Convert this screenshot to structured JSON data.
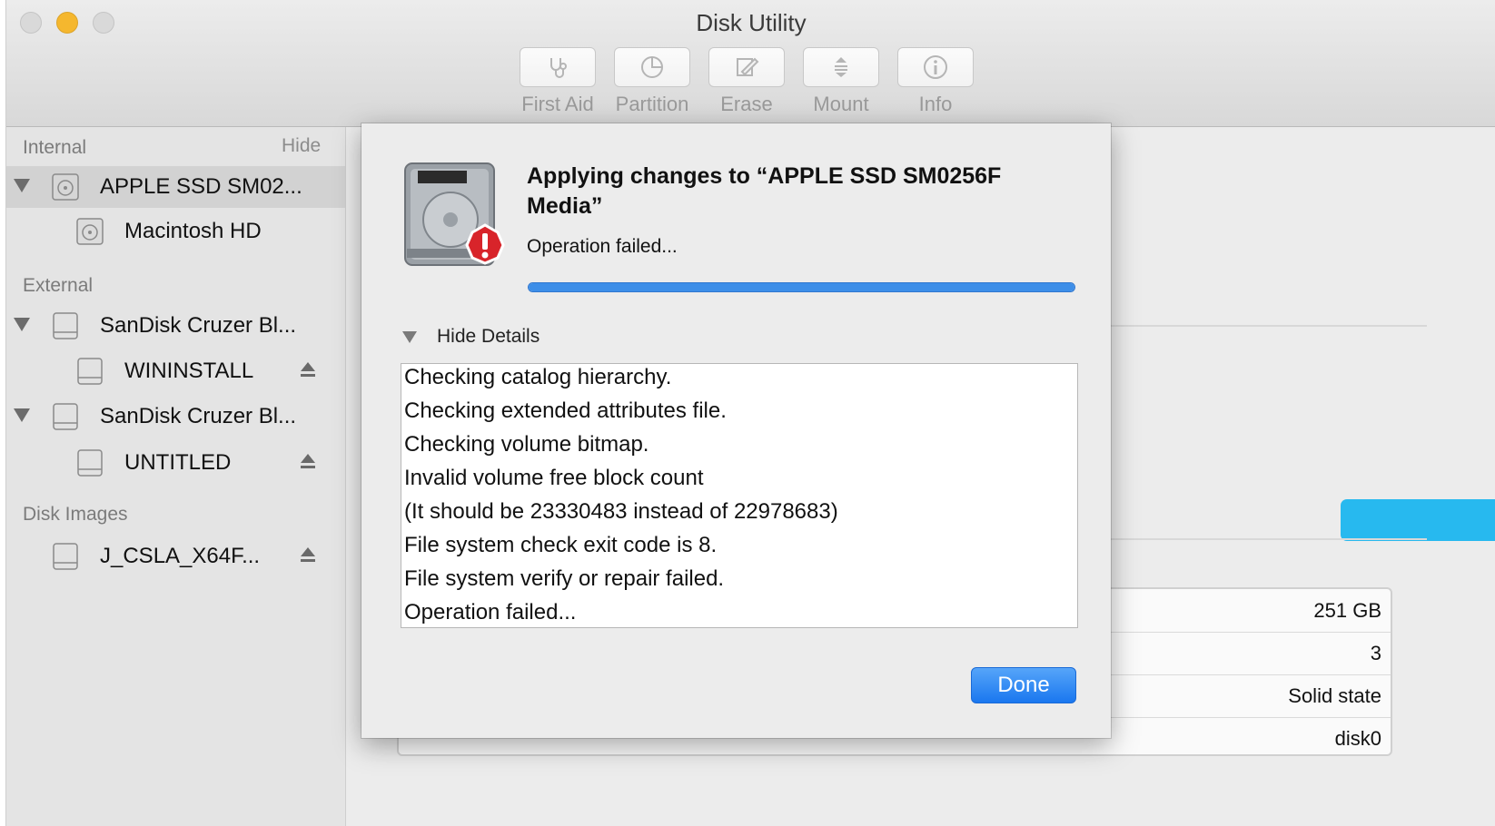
{
  "window": {
    "title": "Disk Utility"
  },
  "toolbar": {
    "buttons": [
      {
        "label": "First Aid",
        "icon": "stethoscope-icon"
      },
      {
        "label": "Partition",
        "icon": "pie-chart-icon"
      },
      {
        "label": "Erase",
        "icon": "pencil-eraser-icon"
      },
      {
        "label": "Mount",
        "icon": "mount-icon"
      },
      {
        "label": "Info",
        "icon": "info-icon"
      }
    ]
  },
  "sidebar": {
    "internal": {
      "heading": "Internal",
      "hide_label": "Hide",
      "disk": "APPLE SSD SM02...",
      "volume": "Macintosh HD"
    },
    "external": {
      "heading": "External",
      "disk1": "SanDisk Cruzer Bl...",
      "volume1": "WININSTALL",
      "disk2": "SanDisk Cruzer Bl...",
      "volume2": "UNTITLED"
    },
    "disk_images": {
      "heading": "Disk Images",
      "image1": "J_CSLA_X64F..."
    }
  },
  "main": {
    "usage_bar_color": "#27b9ef",
    "info_values": [
      "251 GB",
      "3",
      "Solid state",
      "disk0"
    ]
  },
  "dialog": {
    "title": "Applying changes to “APPLE SSD SM0256F Media”",
    "status": "Operation failed...",
    "progress": 1.0,
    "details_toggle": "Hide Details",
    "log_lines": [
      "Checking catalog hierarchy.",
      "Checking extended attributes file.",
      "Checking volume bitmap.",
      "Invalid volume free block count",
      "(It should be 23330483 instead of 22978683)",
      "File system check exit code is 8.",
      "File system verify or repair failed.",
      "Operation failed..."
    ],
    "done_label": "Done",
    "accent_color": "#1a77ef"
  }
}
